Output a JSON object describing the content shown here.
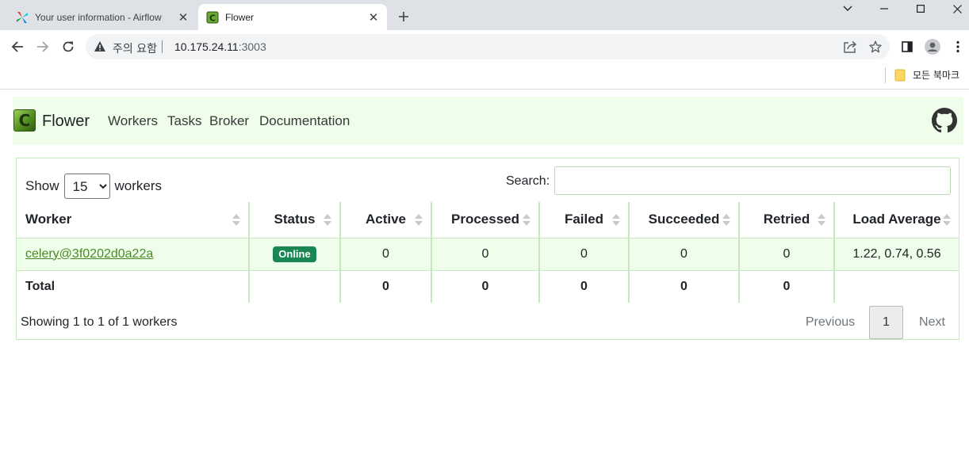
{
  "browser": {
    "tabs": [
      {
        "title": "Your user information - Airflow",
        "active": false,
        "icon": "airflow-icon"
      },
      {
        "title": "Flower",
        "active": true,
        "icon": "flower-icon"
      }
    ],
    "address": {
      "security_label": "주의 요함",
      "host": "10.175.24.11",
      "port": ":3003"
    },
    "bookmarks": {
      "all_bookmarks_label": "모든 북마크"
    }
  },
  "navbar": {
    "brand_letter": "C",
    "brand": "Flower",
    "links": [
      "Workers",
      "Tasks",
      "Broker",
      "Documentation"
    ]
  },
  "workers_table": {
    "length_prefix": "Show",
    "length_value": "15",
    "length_options": [
      "15"
    ],
    "length_suffix": "workers",
    "search_label": "Search:",
    "search_value": "",
    "columns": [
      "Worker",
      "Status",
      "Active",
      "Processed",
      "Failed",
      "Succeeded",
      "Retried",
      "Load Average"
    ],
    "rows": [
      {
        "worker": "celery@3f0202d0a22a",
        "status": "Online",
        "active": "0",
        "processed": "0",
        "failed": "0",
        "succeeded": "0",
        "retried": "0",
        "load_average": "1.22, 0.74, 0.56"
      }
    ],
    "total": {
      "label": "Total",
      "active": "0",
      "processed": "0",
      "failed": "0",
      "succeeded": "0",
      "retried": "0"
    },
    "info": "Showing 1 to 1 of 1 workers",
    "pagination": {
      "previous": "Previous",
      "current": "1",
      "next": "Next"
    }
  },
  "colors": {
    "navbar_bg": "#eefeea",
    "border": "#c6e8bf",
    "link": "#4a8a25",
    "status_online": "#198754"
  }
}
